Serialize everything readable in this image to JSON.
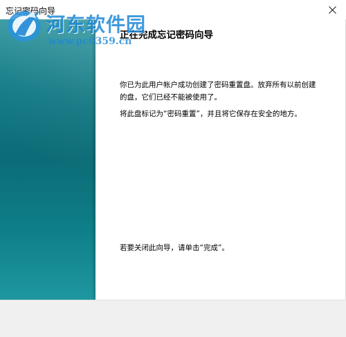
{
  "window": {
    "title": "忘记密码向导"
  },
  "watermark": {
    "site_name": "河东软件园",
    "site_url": "www.pc0359.cn"
  },
  "page": {
    "heading": "正在完成忘记密码向导",
    "paragraph1": "你已为此用户帐户成功创建了密码重置盘。放弃所有以前创建的盘，它们已经不能被使用了。",
    "paragraph2": "将此盘标记为“密码重置”，并且将它保存在安全的地方。",
    "paragraph3": "若要关闭此向导，请单击“完成”。"
  },
  "icons": {
    "close": "close-icon",
    "watermark_logo": "watermark-logo-icon"
  },
  "colors": {
    "side_panel": "#0f7883",
    "watermark": "#1e88d6",
    "footer": "#f0f0f0"
  }
}
